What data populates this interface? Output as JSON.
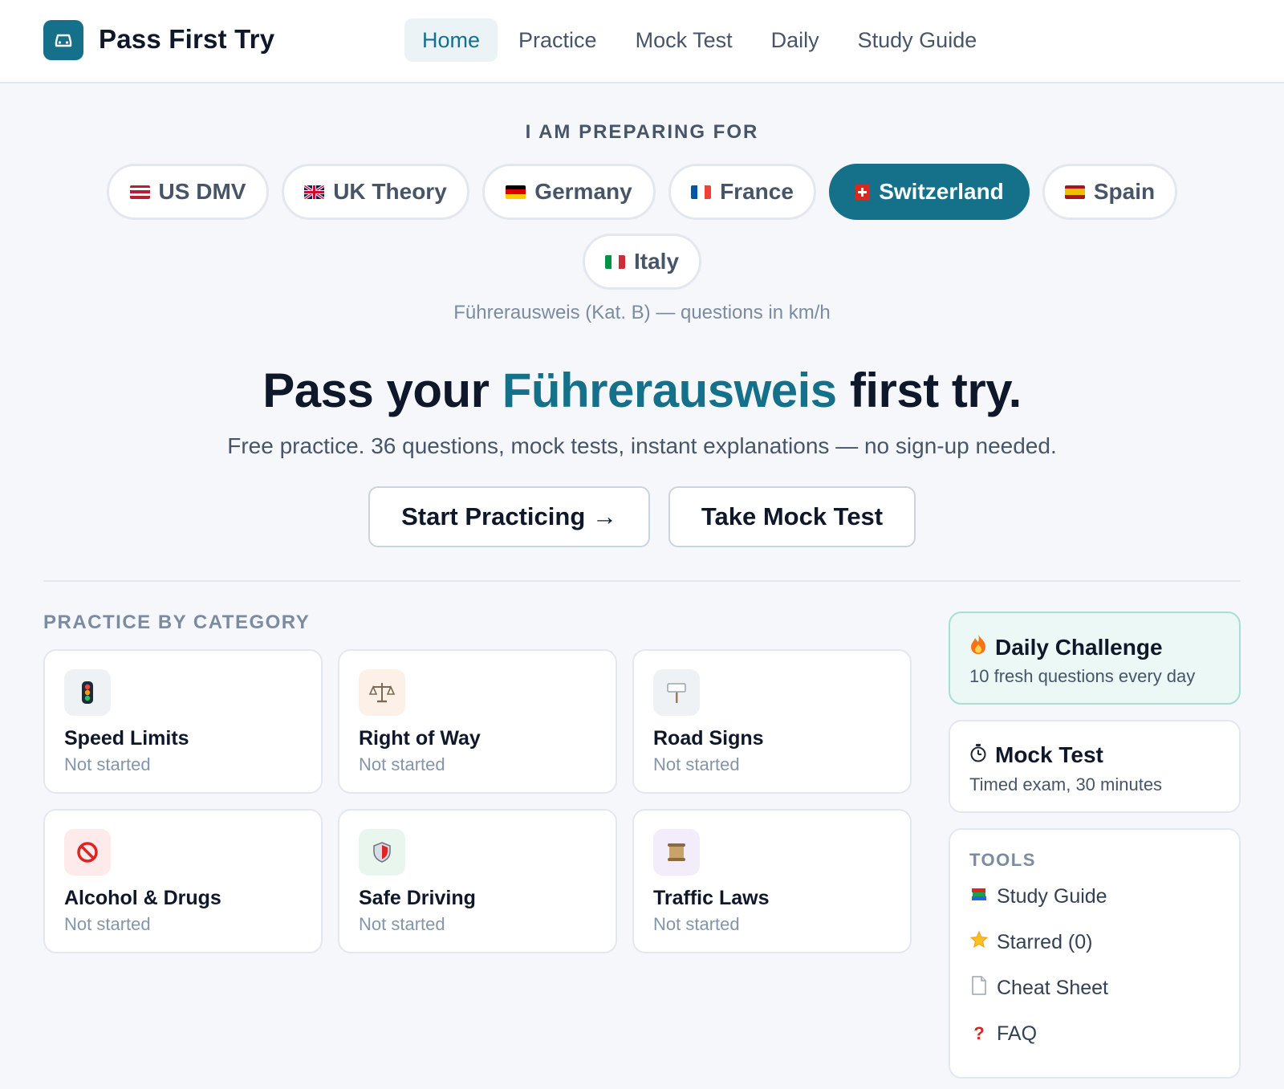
{
  "header": {
    "brand": "Pass First Try",
    "nav": [
      "Home",
      "Practice",
      "Mock Test",
      "Daily",
      "Study Guide"
    ],
    "active_nav": "Home"
  },
  "selector": {
    "heading": "I AM PREPARING FOR",
    "countries": [
      "US DMV",
      "UK Theory",
      "Germany",
      "France",
      "Switzerland",
      "Spain",
      "Italy"
    ],
    "selected": "Switzerland",
    "license_note": "Führerausweis (Kat. B) — questions in km/h"
  },
  "hero": {
    "title_pre": "Pass your ",
    "title_accent": "Führerausweis",
    "title_post": " first try.",
    "subtitle": "Free practice. 36 questions, mock tests, instant explanations — no sign-up needed.",
    "start_button": "Start Practicing →",
    "mock_button": "Take Mock Test"
  },
  "categories": {
    "label": "PRACTICE BY CATEGORY",
    "items": [
      {
        "name": "Speed Limits",
        "status": "Not started",
        "icon": "traffic-light-icon"
      },
      {
        "name": "Right of Way",
        "status": "Not started",
        "icon": "scales-icon"
      },
      {
        "name": "Road Signs",
        "status": "Not started",
        "icon": "signpost-icon"
      },
      {
        "name": "Alcohol & Drugs",
        "status": "Not started",
        "icon": "prohibited-icon"
      },
      {
        "name": "Safe Driving",
        "status": "Not started",
        "icon": "shield-icon"
      },
      {
        "name": "Traffic Laws",
        "status": "Not started",
        "icon": "scroll-icon"
      }
    ]
  },
  "sidebar": {
    "daily": {
      "title": "Daily Challenge",
      "subtitle": "10 fresh questions every day"
    },
    "mock": {
      "title": "Mock Test",
      "subtitle": "Timed exam, 30 minutes"
    },
    "tools": {
      "label": "TOOLS",
      "items": [
        {
          "label": "Study Guide",
          "icon": "books-icon"
        },
        {
          "label": "Starred (0)",
          "icon": "star-icon"
        },
        {
          "label": "Cheat Sheet",
          "icon": "page-icon"
        },
        {
          "label": "FAQ",
          "icon": "question-icon"
        }
      ]
    }
  },
  "colors": {
    "accent": "#15708a",
    "background": "#f5f7fa",
    "daily_bg": "#ebf8f6"
  }
}
